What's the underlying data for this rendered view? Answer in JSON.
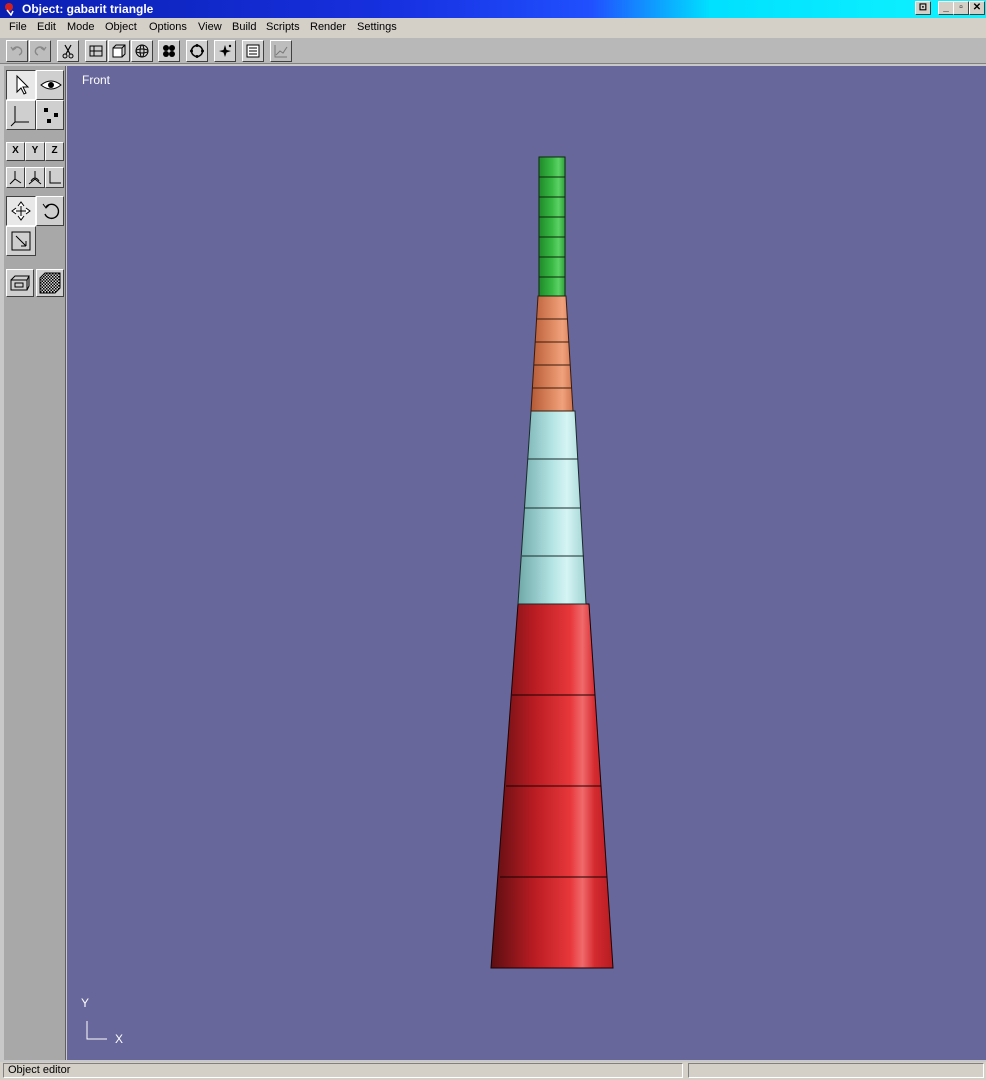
{
  "window": {
    "title": "Object: gabarit triangle",
    "controls": {
      "restore_tab": "⊡",
      "minimize": "_",
      "maximize": "▫",
      "close": "✕"
    }
  },
  "menu": [
    "File",
    "Edit",
    "Mode",
    "Object",
    "Options",
    "View",
    "Build",
    "Scripts",
    "Render",
    "Settings"
  ],
  "toolbar": {
    "icons": [
      "undo-icon",
      "redo-icon",
      "cut-icon",
      "box-view-icon",
      "cube-icon",
      "sphere-icon",
      "points-icon",
      "loop-icon",
      "sparkle-icon",
      "list-icon",
      "chart-icon"
    ]
  },
  "tools": {
    "axis_x": "X",
    "axis_y": "Y",
    "axis_z": "Z"
  },
  "viewport": {
    "view_name": "Front",
    "background": "#67679b",
    "axis_y_label": "Y",
    "axis_x_label": "X",
    "segment_colors": {
      "top": "#2fb13a",
      "upper_mid": "#d9825a",
      "lower_mid": "#a9dcdc",
      "bottom": "#d8282d"
    }
  },
  "status": {
    "text": "Object editor"
  }
}
